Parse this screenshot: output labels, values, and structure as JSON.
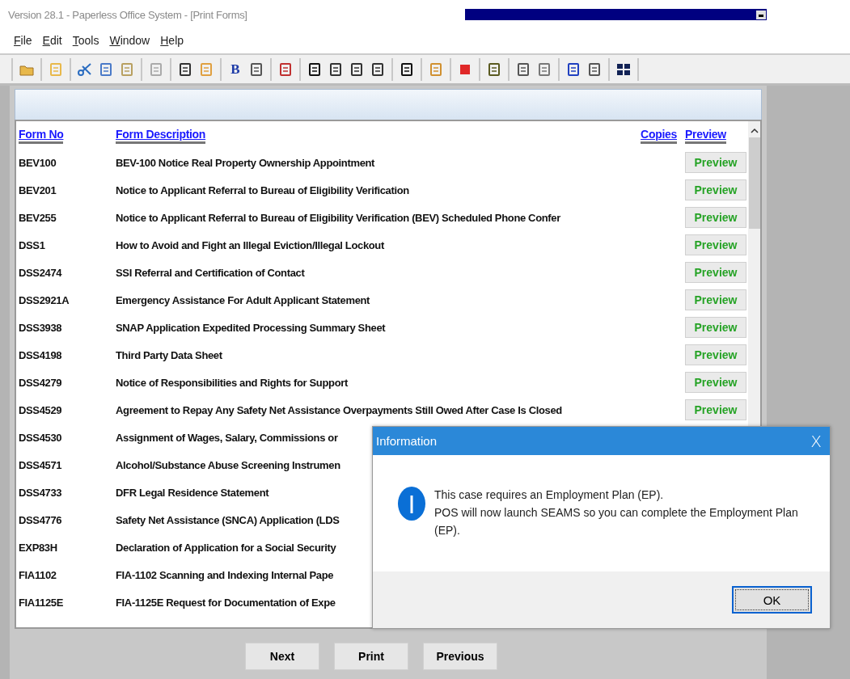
{
  "window": {
    "title": "Version 28.1 - Paperless Office System - [Print Forms]"
  },
  "menu": [
    {
      "label": "File"
    },
    {
      "label": "Edit"
    },
    {
      "label": "Tools"
    },
    {
      "label": "Window"
    },
    {
      "label": "Help"
    }
  ],
  "toolbar": {
    "bold_label": "B"
  },
  "table": {
    "columns": [
      "Form No",
      "Form Description",
      "Copies",
      "Preview"
    ],
    "rows": [
      {
        "form_no": "BEV100",
        "description": "BEV-100 Notice Real Property Ownership Appointment",
        "preview": "Preview"
      },
      {
        "form_no": "BEV201",
        "description": "Notice to Applicant Referral to Bureau of Eligibility Verification",
        "preview": "Preview"
      },
      {
        "form_no": "BEV255",
        "description": "Notice to Applicant Referral to Bureau of Eligibility Verification (BEV) Scheduled Phone Confer",
        "preview": "Preview"
      },
      {
        "form_no": "DSS1",
        "description": "How to Avoid and Fight an Illegal Eviction/Illegal Lockout",
        "preview": "Preview"
      },
      {
        "form_no": "DSS2474",
        "description": "SSI Referral and Certification of Contact",
        "preview": "Preview"
      },
      {
        "form_no": "DSS2921A",
        "description": "Emergency Assistance For Adult Applicant Statement",
        "preview": "Preview"
      },
      {
        "form_no": "DSS3938",
        "description": "SNAP Application Expedited Processing Summary Sheet",
        "preview": "Preview"
      },
      {
        "form_no": "DSS4198",
        "description": "Third Party Data Sheet",
        "preview": "Preview"
      },
      {
        "form_no": "DSS4279",
        "description": "Notice of Responsibilities and Rights for Support",
        "preview": "Preview"
      },
      {
        "form_no": "DSS4529",
        "description": "Agreement to Repay Any Safety Net Assistance Overpayments Still Owed After Case Is Closed",
        "preview": "Preview"
      },
      {
        "form_no": "DSS4530",
        "description": "Assignment of Wages, Salary, Commissions or"
      },
      {
        "form_no": "DSS4571",
        "description": "Alcohol/Substance Abuse Screening Instrumen"
      },
      {
        "form_no": "DSS4733",
        "description": "DFR Legal Residence Statement"
      },
      {
        "form_no": "DSS4776",
        "description": "Safety Net Assistance (SNCA) Application (LDS"
      },
      {
        "form_no": "EXP83H",
        "description": "Declaration of Application for a Social Security"
      },
      {
        "form_no": "FIA1102",
        "description": "FIA-1102 Scanning and Indexing Internal Pape"
      },
      {
        "form_no": "FIA1125E",
        "description": "FIA-1125E Request for Documentation of Expe"
      }
    ]
  },
  "buttons": [
    "Next",
    "Print",
    "Previous"
  ],
  "dialog": {
    "title": "Information",
    "close": "X",
    "lines": [
      "This case requires an Employment Plan (EP).",
      "POS will now launch SEAMS so you can complete the Employment Plan (EP)."
    ],
    "ok": "OK"
  }
}
